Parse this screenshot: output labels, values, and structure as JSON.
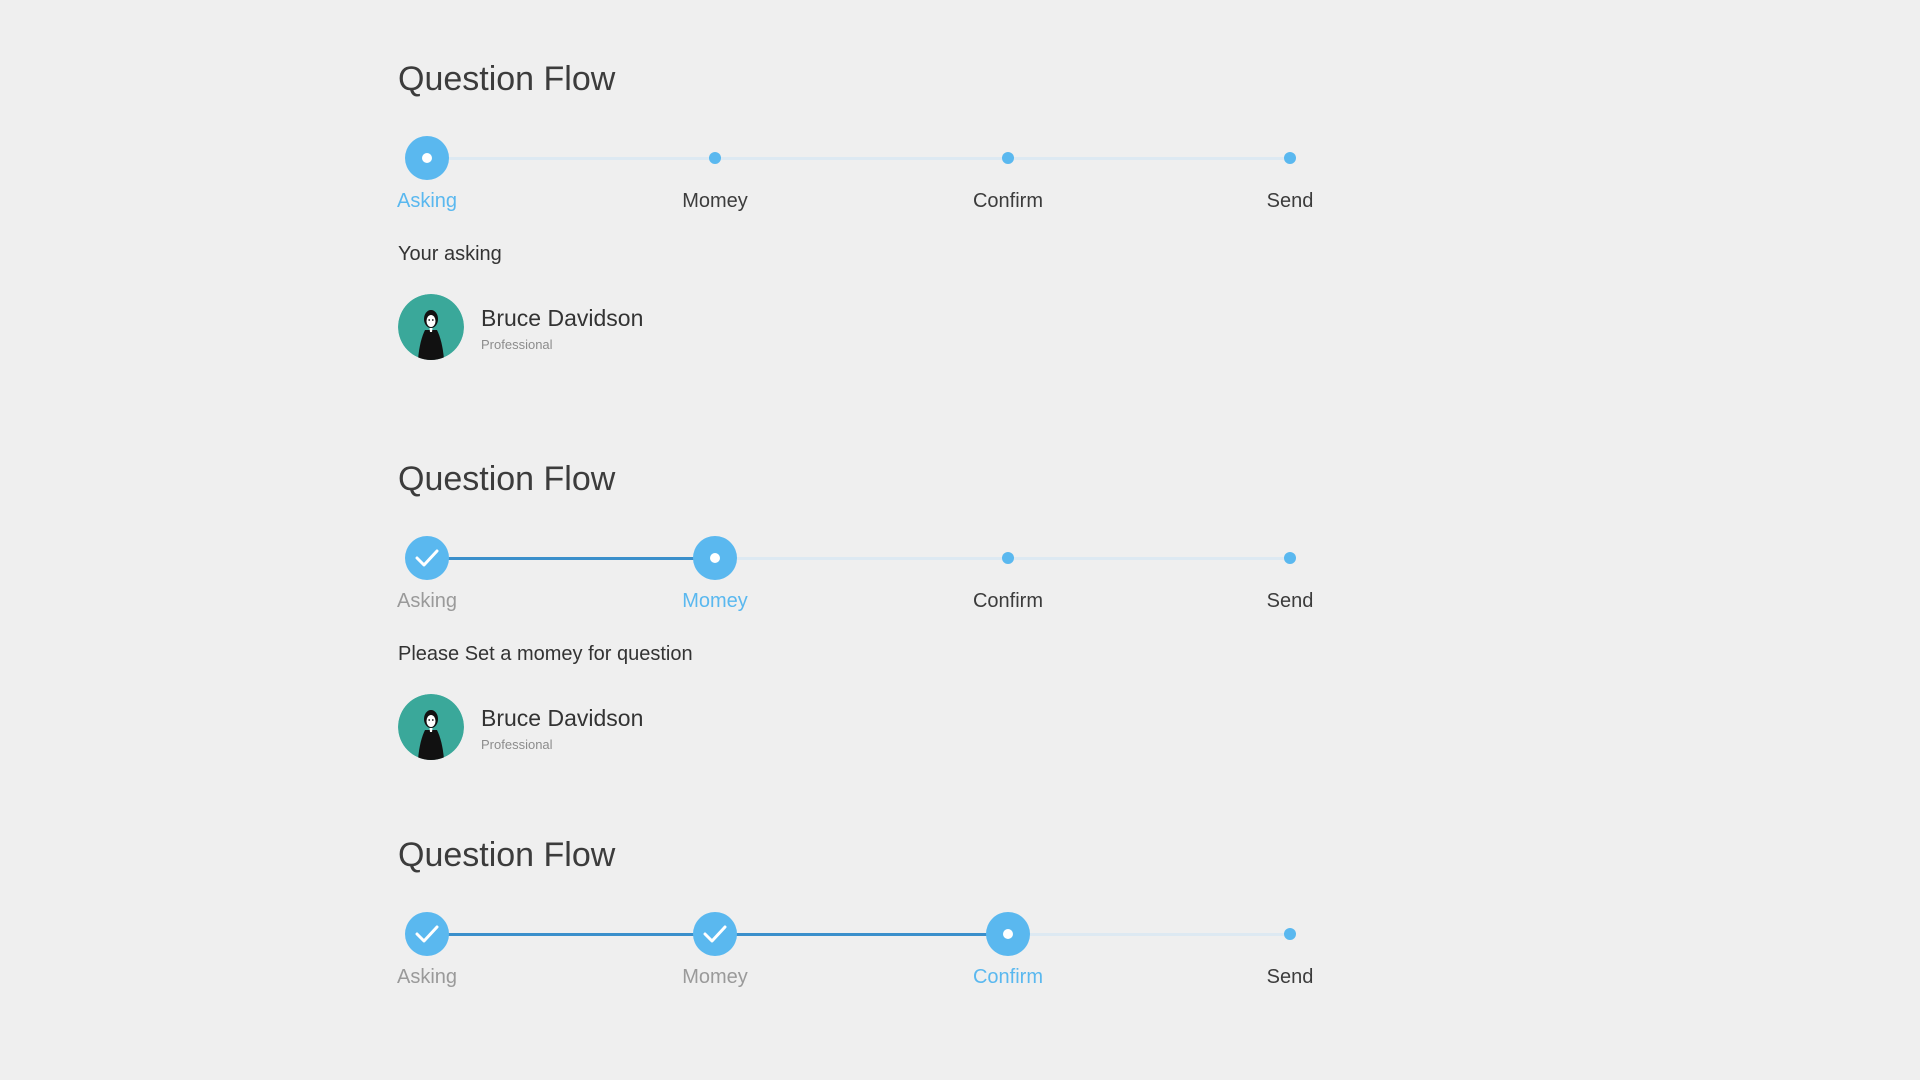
{
  "colors": {
    "background": "#efefef",
    "accent": "#5ab8ef",
    "completed_track": "#3a8fcb",
    "pending_track": "#dde9f2",
    "avatar_bg": "#3aa89a"
  },
  "flows": [
    {
      "title": "Question Flow",
      "steps": [
        {
          "label": "Asking",
          "state": "current"
        },
        {
          "label": "Momey",
          "state": "pending"
        },
        {
          "label": "Confirm",
          "state": "pending"
        },
        {
          "label": "Send",
          "state": "pending"
        }
      ],
      "prompt": "Your asking",
      "user": {
        "name": "Bruce Davidson",
        "role": "Professional"
      }
    },
    {
      "title": "Question Flow",
      "steps": [
        {
          "label": "Asking",
          "state": "completed"
        },
        {
          "label": "Momey",
          "state": "current"
        },
        {
          "label": "Confirm",
          "state": "pending"
        },
        {
          "label": "Send",
          "state": "pending"
        }
      ],
      "prompt": "Please Set a momey for question",
      "user": {
        "name": "Bruce Davidson",
        "role": "Professional"
      }
    },
    {
      "title": "Question Flow",
      "steps": [
        {
          "label": "Asking",
          "state": "completed"
        },
        {
          "label": "Momey",
          "state": "completed"
        },
        {
          "label": "Confirm",
          "state": "current"
        },
        {
          "label": "Send",
          "state": "pending"
        }
      ],
      "icons": {
        "step_done": "check-icon",
        "avatar": "person-icon"
      }
    }
  ]
}
